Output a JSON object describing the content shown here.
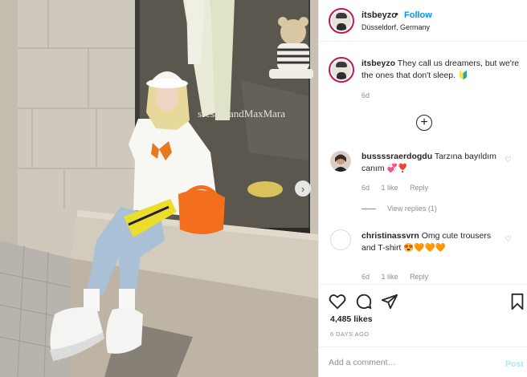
{
  "post": {
    "username": "itsbeyzo",
    "follow_label": "Follow",
    "separator": "•",
    "location": "Düsseldorf, Germany",
    "caption": {
      "username": "itsbeyzo",
      "text": "They call us dreamers, but we're the ones that don't sleep.",
      "emoji": "🔰",
      "time": "6d"
    },
    "storefront_sign": "ssesalstandMaxMara",
    "load_more_icon": "plus-circle-icon"
  },
  "comments": [
    {
      "username": "bussssraerdogdu",
      "text": "Tarzına bayıldım canım",
      "emoji": "💞❣️",
      "time": "6d",
      "likes": "1 like",
      "reply_label": "Reply"
    },
    {
      "username": "christinassvrn",
      "text": "Omg cute trousers and T-shirt",
      "emoji": "😍🧡🧡🧡",
      "time": "6d",
      "likes": "1 like",
      "reply_label": "Reply"
    }
  ],
  "view_replies": "View replies (1)",
  "actions": {
    "icons": [
      "heart-icon",
      "comment-icon",
      "share-icon",
      "bookmark-icon"
    ]
  },
  "likes_count": "4,485 likes",
  "date": "6 DAYS AGO",
  "add_comment": {
    "placeholder": "Add a comment…",
    "post_label": "Post"
  },
  "colors": {
    "follow_blue": "#0095f6",
    "post_disabled": "#b2dffc",
    "muted": "#8e8e8e",
    "story_ring": "#c7145a"
  }
}
